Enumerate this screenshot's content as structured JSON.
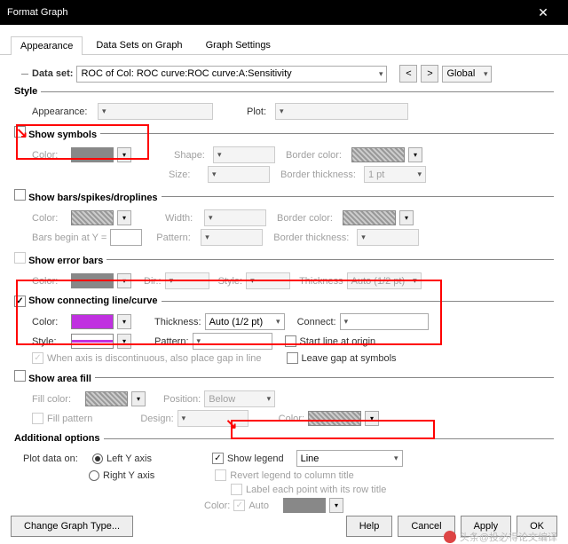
{
  "window": {
    "title": "Format Graph"
  },
  "tabs": {
    "t0": "Appearance",
    "t1": "Data Sets on Graph",
    "t2": "Graph Settings"
  },
  "dataset": {
    "label": "Data set:",
    "value": "ROC of Col: ROC curve:ROC curve:A:Sensitivity",
    "global": "Global"
  },
  "style": {
    "legend": "Style",
    "appearance_lbl": "Appearance:",
    "plot_lbl": "Plot:"
  },
  "symbols": {
    "legend": "Show symbols",
    "color": "Color:",
    "shape": "Shape:",
    "border_color": "Border color:",
    "size": "Size:",
    "border_thickness": "Border thickness:",
    "bt_val": "1 pt"
  },
  "bars": {
    "legend": "Show bars/spikes/droplines",
    "color": "Color:",
    "width": "Width:",
    "border_color": "Border color:",
    "begin": "Bars begin at Y =",
    "pattern": "Pattern:",
    "border_thickness": "Border thickness:"
  },
  "error": {
    "legend": "Show error bars",
    "color": "Color:",
    "dir": "Dir.:",
    "style": "Style:",
    "thickness": "Thickness",
    "t_val": "Auto (1/2 pt)"
  },
  "line": {
    "legend": "Show connecting line/curve",
    "color": "Color:",
    "thickness": "Thickness:",
    "t_val": "Auto (1/2 pt)",
    "connect": "Connect:",
    "style": "Style:",
    "pattern": "Pattern:",
    "start_origin": "Start line at origin",
    "gap_symbols": "Leave gap at symbols",
    "discont": "When axis is discontinuous, also place gap in line"
  },
  "area": {
    "legend": "Show area fill",
    "fill_color": "Fill color:",
    "position": "Position:",
    "pos_val": "Below",
    "fill_pattern": "Fill pattern",
    "design": "Design:",
    "color": "Color:"
  },
  "additional": {
    "legend": "Additional options",
    "plot_on": "Plot data on:",
    "left": "Left Y axis",
    "right": "Right  Y axis",
    "show_legend": "Show legend",
    "legend_val": "Line",
    "revert": "Revert legend to column title",
    "label_row": "Label each point with its row title",
    "color": "Color:",
    "auto": "Auto"
  },
  "footer": {
    "change": "Change Graph Type...",
    "help": "Help",
    "cancel": "Cancel",
    "apply": "Apply",
    "ok": "OK"
  },
  "watermark": "头条@投必得论文编译"
}
